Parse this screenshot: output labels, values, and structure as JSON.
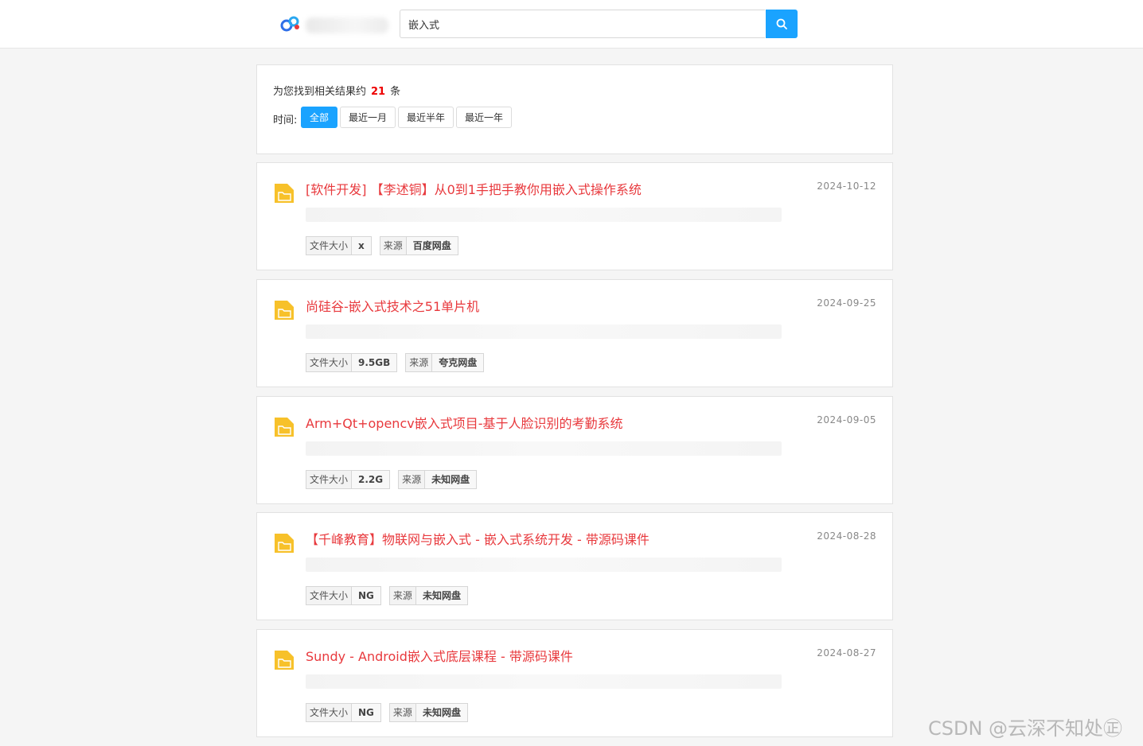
{
  "search": {
    "query": "嵌入式"
  },
  "summary": {
    "prefix": "为您找到相关结果约",
    "count": "21",
    "suffix": "条"
  },
  "time_filter": {
    "label": "时间:",
    "options": [
      "全部",
      "最近一月",
      "最近半年",
      "最近一年"
    ],
    "active": "全部"
  },
  "results": [
    {
      "title": "[软件开发] 【李述铜】从0到1手把手教你用嵌入式操作系统",
      "date": "2024-10-12",
      "size_label": "文件大小",
      "size": "x",
      "source_label": "来源",
      "source": "百度网盘"
    },
    {
      "title": "尚硅谷-嵌入式技术之51单片机",
      "date": "2024-09-25",
      "size_label": "文件大小",
      "size": "9.5GB",
      "source_label": "来源",
      "source": "夸克网盘"
    },
    {
      "title": "Arm+Qt+opencv嵌入式项目-基于人脸识别的考勤系统",
      "date": "2024-09-05",
      "size_label": "文件大小",
      "size": "2.2G",
      "source_label": "来源",
      "source": "未知网盘"
    },
    {
      "title": "【千峰教育】物联网与嵌入式 - 嵌入式系统开发 - 带源码课件",
      "date": "2024-08-28",
      "size_label": "文件大小",
      "size": "NG",
      "source_label": "来源",
      "source": "未知网盘"
    },
    {
      "title": "Sundy - Android嵌入式底层课程 - 带源码课件",
      "date": "2024-08-27",
      "size_label": "文件大小",
      "size": "NG",
      "source_label": "来源",
      "source": "未知网盘"
    }
  ],
  "watermark": "CSDN @云深不知处㊣",
  "colors": {
    "accent": "#1aa3ff",
    "title": "#e8393d",
    "count": "#ee0000",
    "folder": "#f7c12a"
  },
  "icons": {
    "logo": "cloud-logo-icon",
    "search": "search-icon",
    "result": "folder-icon"
  }
}
